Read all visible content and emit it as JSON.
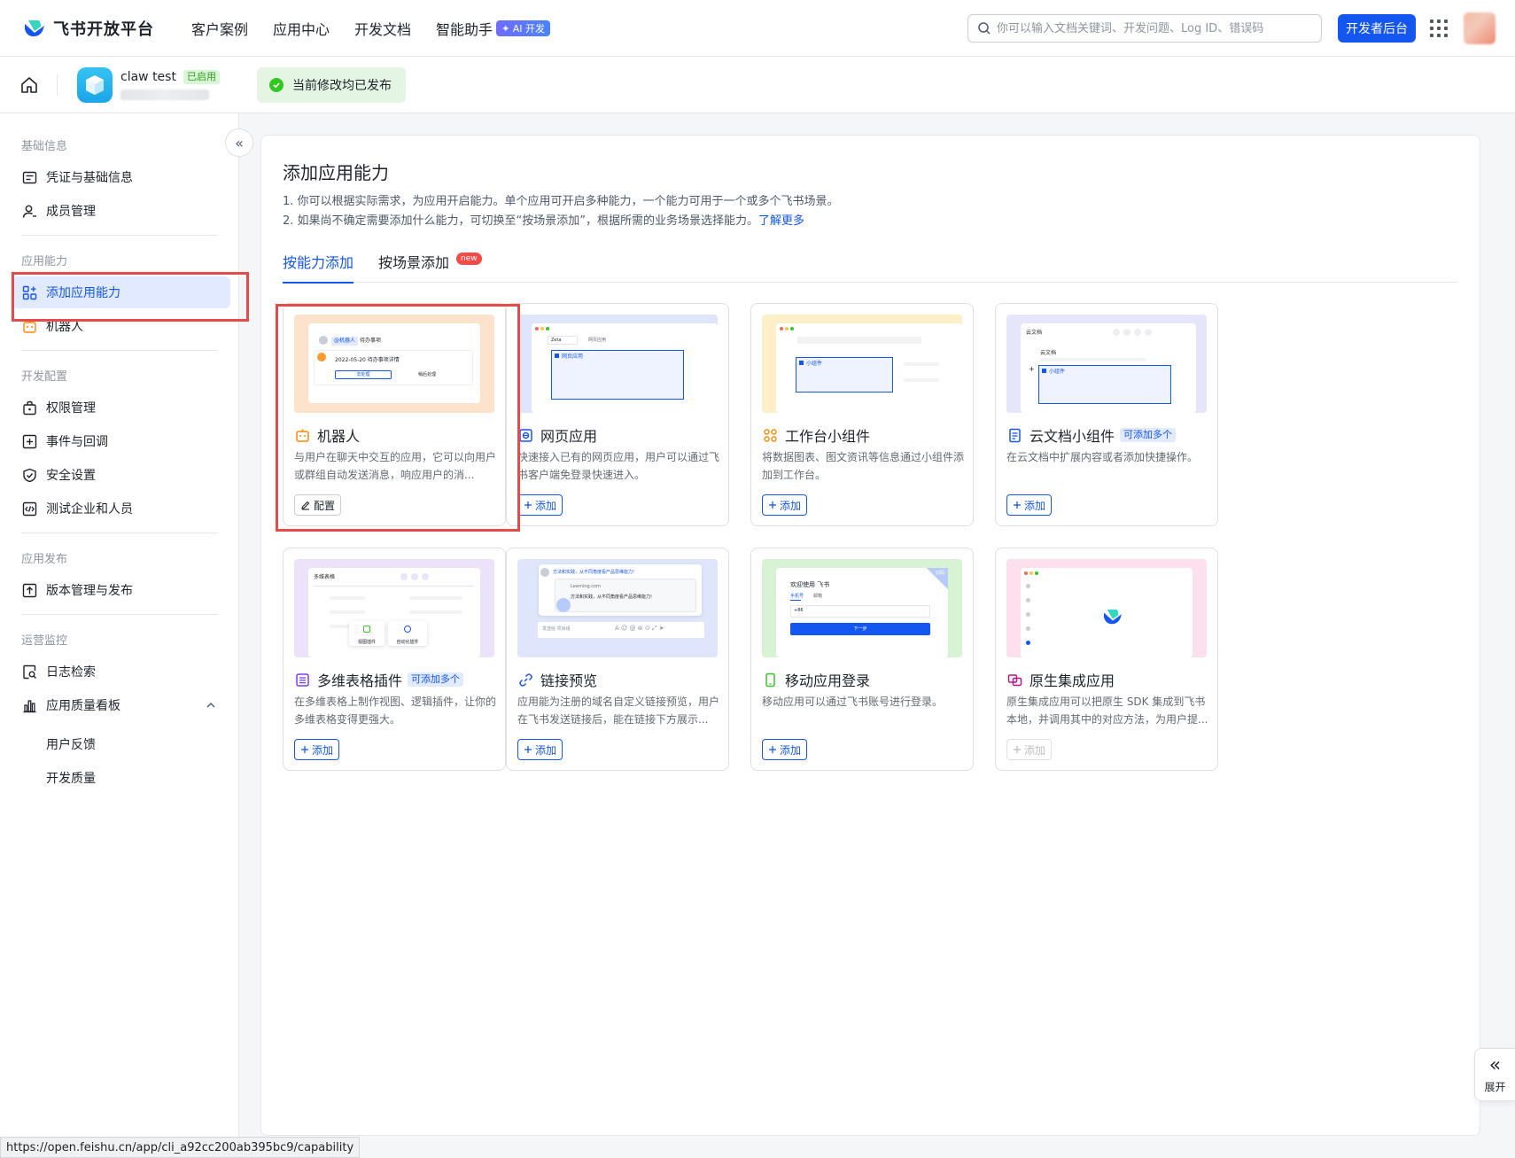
{
  "topnav": {
    "logo_text": "飞书开放平台",
    "items": [
      "客户案例",
      "应用中心",
      "开发文档",
      "智能助手"
    ],
    "ai_badge": "✦ AI 开发",
    "search_placeholder": "你可以输入文档关键词、开发问题、Log ID、错误码",
    "dev_button": "开发者后台"
  },
  "subheader": {
    "app_name": "claw test",
    "app_status": "已启用",
    "publish_status": "当前修改均已发布"
  },
  "sidebar": {
    "collapse_glyph": "«",
    "groups": [
      {
        "title": "基础信息",
        "items": [
          "凭证与基础信息",
          "成员管理"
        ]
      },
      {
        "title": "应用能力",
        "items": [
          "添加应用能力",
          "机器人"
        ]
      },
      {
        "title": "开发配置",
        "items": [
          "权限管理",
          "事件与回调",
          "安全设置",
          "测试企业和人员"
        ]
      },
      {
        "title": "应用发布",
        "items": [
          "版本管理与发布"
        ]
      },
      {
        "title": "运营监控",
        "items": [
          "日志检索",
          "应用质量看板"
        ],
        "subitems": [
          "用户反馈",
          "开发质量"
        ]
      }
    ],
    "active_item": "添加应用能力"
  },
  "main": {
    "title": "添加应用能力",
    "desc1": "1. 你可以根据实际需求，为应用开启能力。单个应用可开启多种能力，一个能力可用于一个或多个飞书场景。",
    "desc2": "2. 如果尚不确定需要添加什么能力，可切换至“按场景添加”，根据所需的业务场景选择能力。",
    "learn_more": "了解更多",
    "tabs": [
      "按能力添加",
      "按场景添加"
    ],
    "new_badge": "new",
    "multi_badge": "可添加多个",
    "cards": [
      {
        "title": "机器人",
        "desc": "与用户在聊天中交互的应用，它可以向用户或群组自动发送消息，响应用户的消...",
        "button": "配置",
        "icon": "robot-icon"
      },
      {
        "title": "网页应用",
        "desc": "快速接入已有的网页应用，用户可以通过飞书客户端免登录快速进入。",
        "button": "添加",
        "icon": "web-app-icon"
      },
      {
        "title": "工作台小组件",
        "desc": "将数据图表、图文资讯等信息通过小组件添加到工作台。",
        "button": "添加",
        "icon": "widget-icon"
      },
      {
        "title": "云文档小组件",
        "desc": "在云文档中扩展内容或者添加快捷操作。",
        "button": "添加",
        "icon": "doc-icon"
      },
      {
        "title": "多维表格插件",
        "desc": "在多维表格上制作视图、逻辑插件，让你的多维表格变得更强大。",
        "button": "添加",
        "icon": "base-plugin-icon"
      },
      {
        "title": "链接预览",
        "desc": "应用能为注册的域名自定义链接预览，用户在飞书发送链接后，能在链接下方展示...",
        "button": "添加",
        "icon": "link-icon"
      },
      {
        "title": "移动应用登录",
        "desc": "移动应用可以通过飞书账号进行登录。",
        "button": "添加",
        "icon": "mobile-icon"
      },
      {
        "title": "原生集成应用",
        "desc": "原生集成应用可以把原生 SDK 集成到飞书本地，并调用其中的对应方法，为用户提...",
        "button": "添加",
        "icon": "native-icon"
      }
    ],
    "previews": {
      "robot": {
        "tag": "@机器人",
        "tag2": "待办事项",
        "date_line": "2022-05-20 待办事项详情",
        "btn1": "去处理",
        "btn2": "稍后处理"
      },
      "web": {
        "tab": "Zeta",
        "tab2": "网页应用",
        "label": "网页应用"
      },
      "widget": {
        "label": "小组件"
      },
      "docwidget": {
        "title": "云文档",
        "subtitle": "云文档",
        "label": "小组件"
      },
      "base": {
        "title": "多维表格",
        "btn1": "视图插件",
        "btn2": "自动化插件"
      },
      "link": {
        "top": "方法和实践，从不同角度看产品思维能力!",
        "url": "Learning.com",
        "body": "方法和实践，从不同角度看产品思维能力!",
        "input": "发送给 项目组"
      },
      "mobile": {
        "title": "欢迎使用 飞书",
        "tab1": "手机号",
        "tab2": "邮箱",
        "code": "+86",
        "btn": "下一步",
        "corner": "扫码"
      }
    }
  },
  "expand": {
    "glyph": "«",
    "label": "展开"
  },
  "status_url": "https://open.feishu.cn/app/cli_a92cc200ab395bc9/capability"
}
